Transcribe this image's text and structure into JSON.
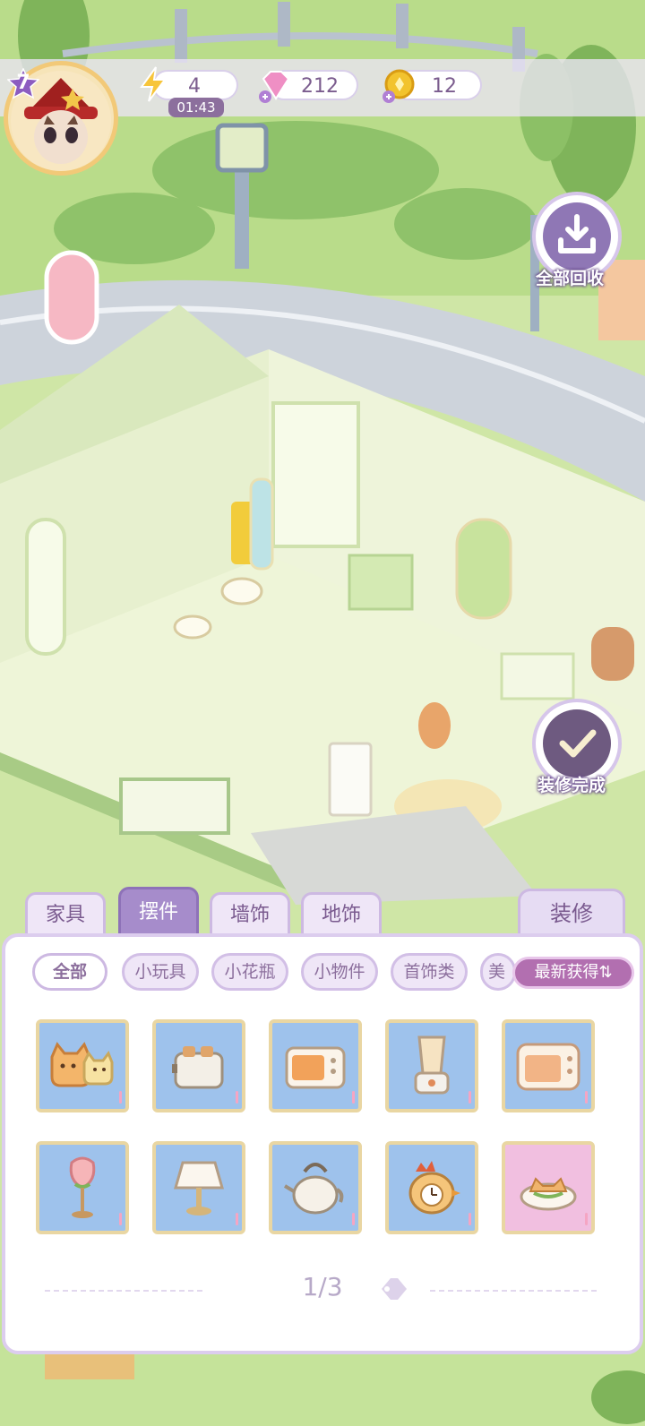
{
  "hud": {
    "level": "7",
    "energy": "4",
    "energy_timer": "01:43",
    "gems": "212",
    "coins": "12"
  },
  "side_buttons": {
    "recycle_all": "全部回收",
    "finish_decorating": "装修完成"
  },
  "tabs": [
    {
      "label": "家具",
      "active": false
    },
    {
      "label": "摆件",
      "active": true
    },
    {
      "label": "墙饰",
      "active": false
    },
    {
      "label": "地饰",
      "active": false
    }
  ],
  "decorate_tab": "装修",
  "categories": [
    {
      "label": "全部",
      "active": true
    },
    {
      "label": "小玩具",
      "active": false
    },
    {
      "label": "小花瓶",
      "active": false
    },
    {
      "label": "小物件",
      "active": false
    },
    {
      "label": "首饰类",
      "active": false
    },
    {
      "label": "美",
      "active": false
    }
  ],
  "sort_label": "最新获得⇅",
  "items": [
    {
      "icon": "cat-cushion-icon"
    },
    {
      "icon": "toaster-icon"
    },
    {
      "icon": "microwave-icon"
    },
    {
      "icon": "blender-icon"
    },
    {
      "icon": "oven-icon"
    },
    {
      "icon": "tulip-lamp-icon"
    },
    {
      "icon": "table-lamp-icon"
    },
    {
      "icon": "teapot-icon"
    },
    {
      "icon": "chicken-clock-icon"
    },
    {
      "icon": "cat-bowl-icon"
    }
  ],
  "pagination": "1/3",
  "colors": {
    "panel_accent": "#a68ccb",
    "item_bg": "#9ec2ec",
    "item_bg_pink": "#f1bfe0",
    "item_border": "#e9d6a2"
  }
}
